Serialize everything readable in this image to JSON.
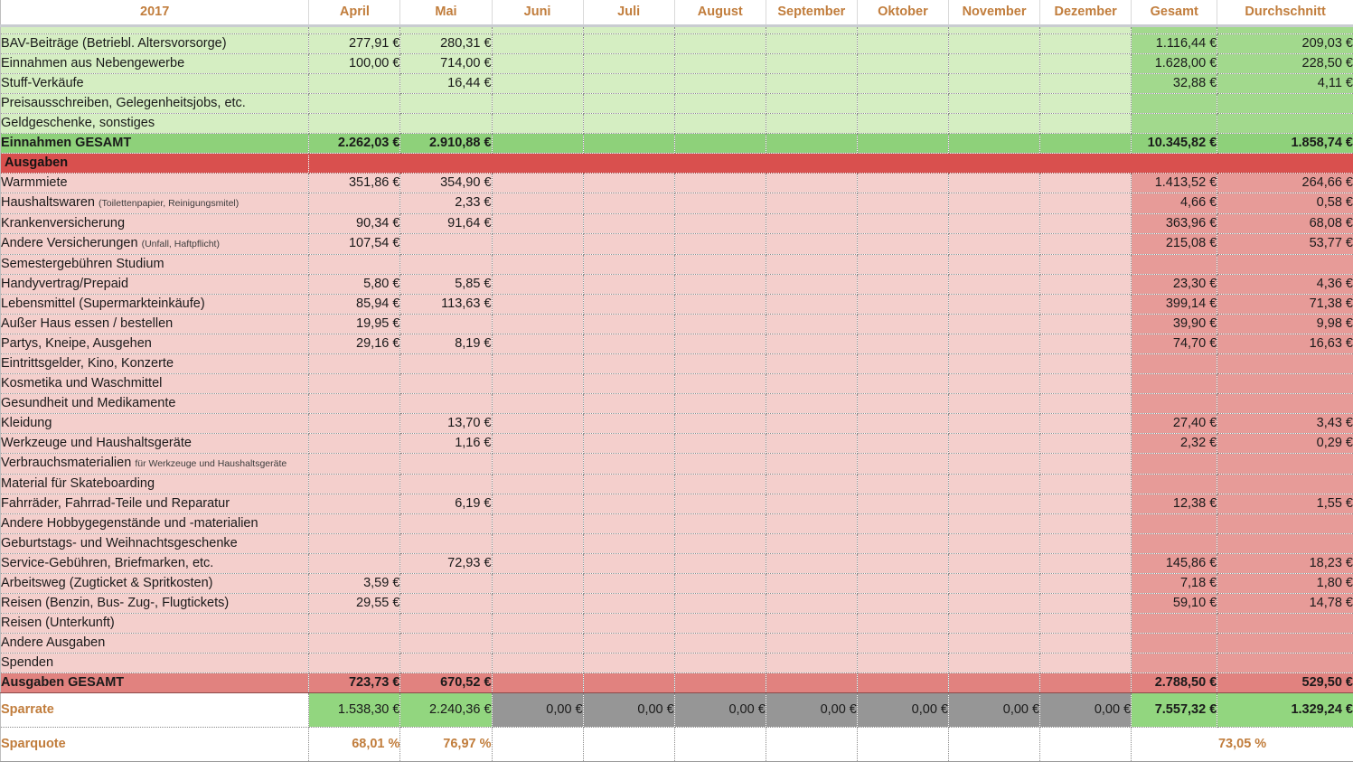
{
  "header": {
    "year_label": "2017",
    "columns": [
      "April",
      "Mai",
      "Juni",
      "Juli",
      "August",
      "September",
      "Oktober",
      "November",
      "Dezember",
      "Gesamt",
      "Durchschnitt"
    ]
  },
  "income": {
    "rows": [
      {
        "label": "BAV-Beiträge (Betriebl. Altersvorsorge)",
        "sub": "",
        "values": [
          "277,91 €",
          "280,31 €",
          "",
          "",
          "",
          "",
          "",
          "",
          "",
          "1.116,44 €",
          "209,03 €"
        ]
      },
      {
        "label": "Einnahmen aus Nebengewerbe",
        "sub": "",
        "values": [
          "100,00 €",
          "714,00 €",
          "",
          "",
          "",
          "",
          "",
          "",
          "",
          "1.628,00 €",
          "228,50 €"
        ]
      },
      {
        "label": "Stuff-Verkäufe",
        "sub": "",
        "values": [
          "",
          "16,44 €",
          "",
          "",
          "",
          "",
          "",
          "",
          "",
          "32,88 €",
          "4,11 €"
        ]
      },
      {
        "label": "Preisausschreiben, Gelegenheitsjobs, etc.",
        "sub": "",
        "values": [
          "",
          "",
          "",
          "",
          "",
          "",
          "",
          "",
          "",
          "",
          ""
        ]
      },
      {
        "label": "Geldgeschenke, sonstiges",
        "sub": "",
        "values": [
          "",
          "",
          "",
          "",
          "",
          "",
          "",
          "",
          "",
          "",
          ""
        ]
      }
    ],
    "total": {
      "label": "Einnahmen GESAMT",
      "values": [
        "2.262,03 €",
        "2.910,88 €",
        "",
        "",
        "",
        "",
        "",
        "",
        "",
        "10.345,82 €",
        "1.858,74 €"
      ]
    }
  },
  "expenses": {
    "section_label": "Ausgaben",
    "rows": [
      {
        "label": "Warmmiete",
        "sub": "",
        "values": [
          "351,86 €",
          "354,90 €",
          "",
          "",
          "",
          "",
          "",
          "",
          "",
          "1.413,52 €",
          "264,66 €"
        ]
      },
      {
        "label": "Haushaltswaren",
        "sub": "(Toilettenpapier, Reinigungsmitel)",
        "values": [
          "",
          "2,33 €",
          "",
          "",
          "",
          "",
          "",
          "",
          "",
          "4,66 €",
          "0,58 €"
        ]
      },
      {
        "label": "Krankenversicherung",
        "sub": "",
        "values": [
          "90,34 €",
          "91,64 €",
          "",
          "",
          "",
          "",
          "",
          "",
          "",
          "363,96 €",
          "68,08 €"
        ]
      },
      {
        "label": "Andere Versicherungen",
        "sub": "(Unfall, Haftpflicht)",
        "values": [
          "107,54 €",
          "",
          "",
          "",
          "",
          "",
          "",
          "",
          "",
          "215,08 €",
          "53,77 €"
        ]
      },
      {
        "label": "Semestergebühren Studium",
        "sub": "",
        "values": [
          "",
          "",
          "",
          "",
          "",
          "",
          "",
          "",
          "",
          "",
          ""
        ]
      },
      {
        "label": "Handyvertrag/Prepaid",
        "sub": "",
        "values": [
          "5,80 €",
          "5,85 €",
          "",
          "",
          "",
          "",
          "",
          "",
          "",
          "23,30 €",
          "4,36 €"
        ]
      },
      {
        "label": "Lebensmittel (Supermarkteinkäufe)",
        "sub": "",
        "values": [
          "85,94 €",
          "113,63 €",
          "",
          "",
          "",
          "",
          "",
          "",
          "",
          "399,14 €",
          "71,38 €"
        ]
      },
      {
        "label": "Außer Haus essen / bestellen",
        "sub": "",
        "values": [
          "19,95 €",
          "",
          "",
          "",
          "",
          "",
          "",
          "",
          "",
          "39,90 €",
          "9,98 €"
        ]
      },
      {
        "label": "Partys, Kneipe, Ausgehen",
        "sub": "",
        "values": [
          "29,16 €",
          "8,19 €",
          "",
          "",
          "",
          "",
          "",
          "",
          "",
          "74,70 €",
          "16,63 €"
        ]
      },
      {
        "label": "Eintrittsgelder, Kino, Konzerte",
        "sub": "",
        "values": [
          "",
          "",
          "",
          "",
          "",
          "",
          "",
          "",
          "",
          "",
          ""
        ]
      },
      {
        "label": "Kosmetika und Waschmittel",
        "sub": "",
        "values": [
          "",
          "",
          "",
          "",
          "",
          "",
          "",
          "",
          "",
          "",
          ""
        ]
      },
      {
        "label": "Gesundheit und Medikamente",
        "sub": "",
        "values": [
          "",
          "",
          "",
          "",
          "",
          "",
          "",
          "",
          "",
          "",
          ""
        ]
      },
      {
        "label": "Kleidung",
        "sub": "",
        "values": [
          "",
          "13,70 €",
          "",
          "",
          "",
          "",
          "",
          "",
          "",
          "27,40 €",
          "3,43 €"
        ]
      },
      {
        "label": "Werkzeuge und Haushaltsgeräte",
        "sub": "",
        "values": [
          "",
          "1,16 €",
          "",
          "",
          "",
          "",
          "",
          "",
          "",
          "2,32 €",
          "0,29 €"
        ]
      },
      {
        "label": "Verbrauchsmaterialien",
        "sub": "für Werkzeuge und Haushaltsgeräte",
        "values": [
          "",
          "",
          "",
          "",
          "",
          "",
          "",
          "",
          "",
          "",
          ""
        ]
      },
      {
        "label": "Material für Skateboarding",
        "sub": "",
        "values": [
          "",
          "",
          "",
          "",
          "",
          "",
          "",
          "",
          "",
          "",
          ""
        ]
      },
      {
        "label": "Fahrräder, Fahrrad-Teile und Reparatur",
        "sub": "",
        "values": [
          "",
          "6,19 €",
          "",
          "",
          "",
          "",
          "",
          "",
          "",
          "12,38 €",
          "1,55 €"
        ]
      },
      {
        "label": "Andere Hobbygegenstände und -materialien",
        "sub": "",
        "values": [
          "",
          "",
          "",
          "",
          "",
          "",
          "",
          "",
          "",
          "",
          ""
        ]
      },
      {
        "label": "Geburtstags- und Weihnachtsgeschenke",
        "sub": "",
        "values": [
          "",
          "",
          "",
          "",
          "",
          "",
          "",
          "",
          "",
          "",
          ""
        ]
      },
      {
        "label": "Service-Gebühren, Briefmarken, etc.",
        "sub": "",
        "values": [
          "",
          "72,93 €",
          "",
          "",
          "",
          "",
          "",
          "",
          "",
          "145,86 €",
          "18,23 €"
        ]
      },
      {
        "label": "Arbeitsweg (Zugticket & Spritkosten)",
        "sub": "",
        "values": [
          "3,59 €",
          "",
          "",
          "",
          "",
          "",
          "",
          "",
          "",
          "7,18 €",
          "1,80 €"
        ]
      },
      {
        "label": "Reisen (Benzin, Bus- Zug-, Flugtickets)",
        "sub": "",
        "values": [
          "29,55 €",
          "",
          "",
          "",
          "",
          "",
          "",
          "",
          "",
          "59,10 €",
          "14,78 €"
        ]
      },
      {
        "label": "Reisen (Unterkunft)",
        "sub": "",
        "values": [
          "",
          "",
          "",
          "",
          "",
          "",
          "",
          "",
          "",
          "",
          ""
        ]
      },
      {
        "label": "Andere Ausgaben",
        "sub": "",
        "values": [
          "",
          "",
          "",
          "",
          "",
          "",
          "",
          "",
          "",
          "",
          ""
        ]
      },
      {
        "label": "Spenden",
        "sub": "",
        "values": [
          "",
          "",
          "",
          "",
          "",
          "",
          "",
          "",
          "",
          "",
          ""
        ]
      }
    ],
    "total": {
      "label": "Ausgaben GESAMT",
      "values": [
        "723,73 €",
        "670,52 €",
        "",
        "",
        "",
        "",
        "",
        "",
        "",
        "2.788,50 €",
        "529,50 €"
      ]
    }
  },
  "savings": {
    "rate": {
      "label": "Sparrate",
      "values": [
        "1.538,30 €",
        "2.240,36 €",
        "0,00 €",
        "0,00 €",
        "0,00 €",
        "0,00 €",
        "0,00 €",
        "0,00 €",
        "0,00 €",
        "7.557,32 €",
        "1.329,24 €"
      ]
    },
    "quote": {
      "label": "Sparquote",
      "values": [
        "68,01 %",
        "76,97 %",
        "",
        "",
        "",
        "",
        "",
        "",
        "",
        ""
      ],
      "merged_total": "73,05 %"
    }
  },
  "colors": {
    "accent_text": "#c17d3c",
    "income_row": "#d5eec2",
    "income_total_col": "#a2d98d",
    "income_sum_row": "#8ed17a",
    "expense_section": "#d9504e",
    "expense_row": "#f4cfcc",
    "expense_total_col": "#e79b98",
    "expense_sum_row": "#e1827f",
    "savings_green": "#92d67f",
    "savings_grey": "#969696"
  }
}
